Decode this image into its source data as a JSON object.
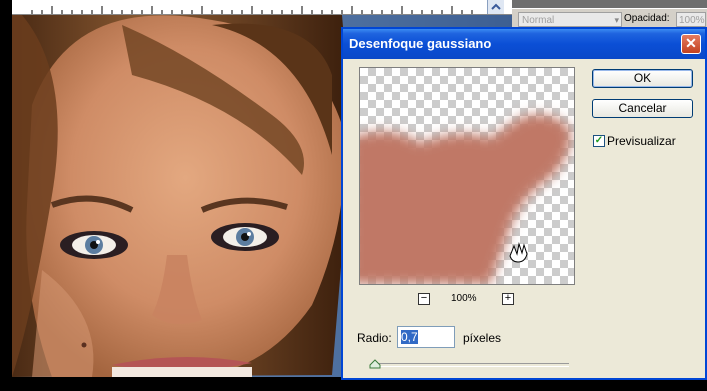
{
  "dialog": {
    "title": "Desenfoque gaussiano",
    "close_glyph": "✕",
    "ok_label": "OK",
    "cancel_label": "Cancelar",
    "preview_label": "Previsualizar",
    "preview_checked": true,
    "zoom_minus": "−",
    "zoom_plus": "+",
    "zoom_level": "100%",
    "radius_label": "Radio:",
    "radius_value": "0,7",
    "radius_units": "píxeles",
    "slider_fraction": 0.02
  },
  "layers_panel": {
    "blend_mode": "Normal",
    "opacity_label": "Opacidad:",
    "opacity_value": "100%"
  },
  "colors": {
    "title_blue": "#0a48c8",
    "skin_preview": "#c07866",
    "dialog_bg": "#ece9d8"
  }
}
